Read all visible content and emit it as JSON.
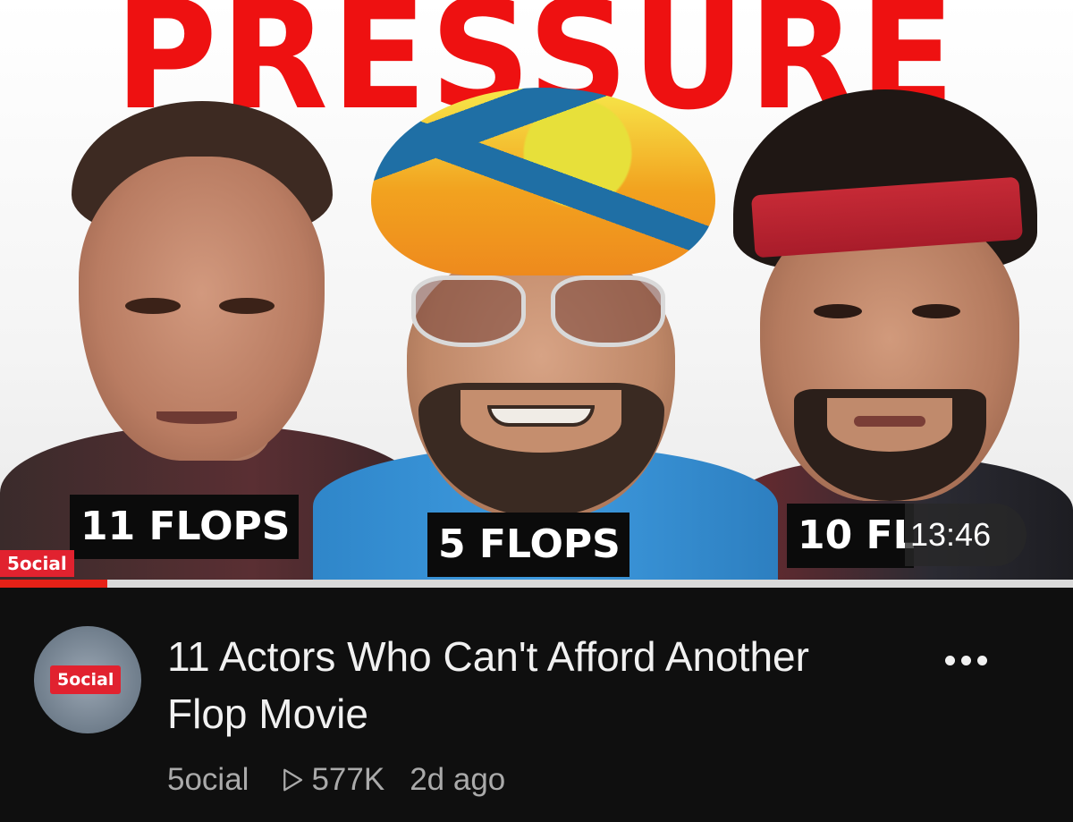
{
  "video": {
    "title": "11 Actors Who Can't Afford Another Flop Movie",
    "channel": "5ocial",
    "views": "577K",
    "age": "2d ago",
    "duration": "13:46",
    "watched_progress": 0.1
  },
  "thumbnail": {
    "headline": "PRESSURE",
    "labels": [
      "11 FLOPS",
      "5 FLOPS",
      "10 FLOPS"
    ],
    "channel_mark": "5ocial"
  },
  "avatar": {
    "badge_text": "5ocial"
  },
  "icons": {
    "views": "play-outline-icon",
    "menu": "more-vert-icon"
  },
  "colors": {
    "headline": "#ee1111",
    "progress": "#e62117",
    "background": "#0f0f0f",
    "secondary_text": "#aaaaaa"
  }
}
